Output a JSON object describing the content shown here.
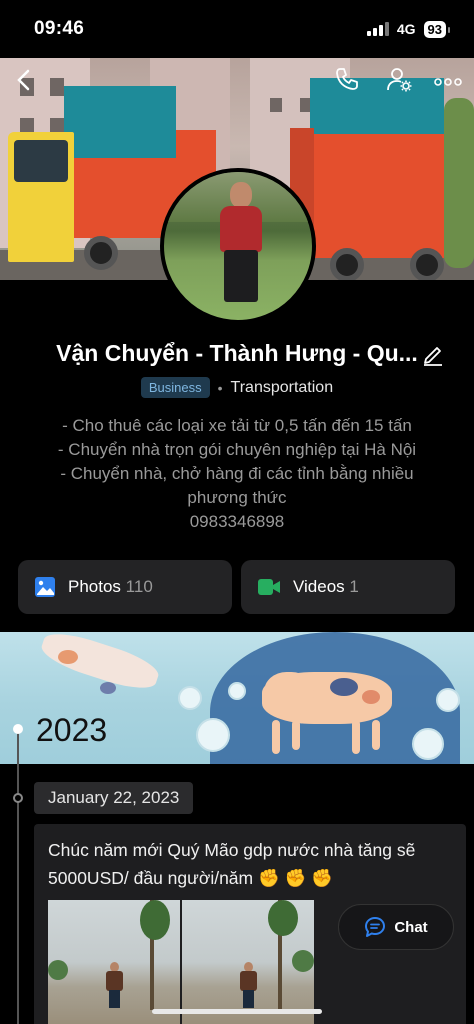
{
  "status_bar": {
    "time": "09:46",
    "network": "4G",
    "battery": "93"
  },
  "cover": {
    "back_icon": "chevron-left-icon",
    "phone_icon": "phone-icon",
    "settings_icon": "user-settings-icon",
    "more_icon": "more-dots-icon"
  },
  "profile": {
    "name": "Vận Chuyển - Thành Hưng - Qu...",
    "badge": "Business",
    "separator": "•",
    "category": "Transportation",
    "bio": [
      "- Cho thuê các loại xe tải từ 0,5 tấn đến 15 tấn",
      "- Chuyển nhà trọn gói chuyên nghiệp tại Hà Nội",
      "-  Chuyển nhà, chở hàng đi các tỉnh bằng nhiều",
      "phương thức",
      "0983346898"
    ]
  },
  "media": {
    "photos_label": "Photos",
    "photos_count": "110",
    "videos_label": "Videos",
    "videos_count": "1"
  },
  "timeline": {
    "year": "2023",
    "date": "January 22, 2023",
    "post_text": "Chúc năm mới Quý Mão gdp nước nhà tăng sẽ 5000USD/ đầu người/năm ✊ ✊ ✊"
  },
  "chat": {
    "label": "Chat"
  },
  "colors": {
    "accent_blue": "#2f80ed",
    "photos_icon": "#2f80ed",
    "videos_icon": "#27ae60",
    "badge_bg": "#1f3a4e"
  }
}
